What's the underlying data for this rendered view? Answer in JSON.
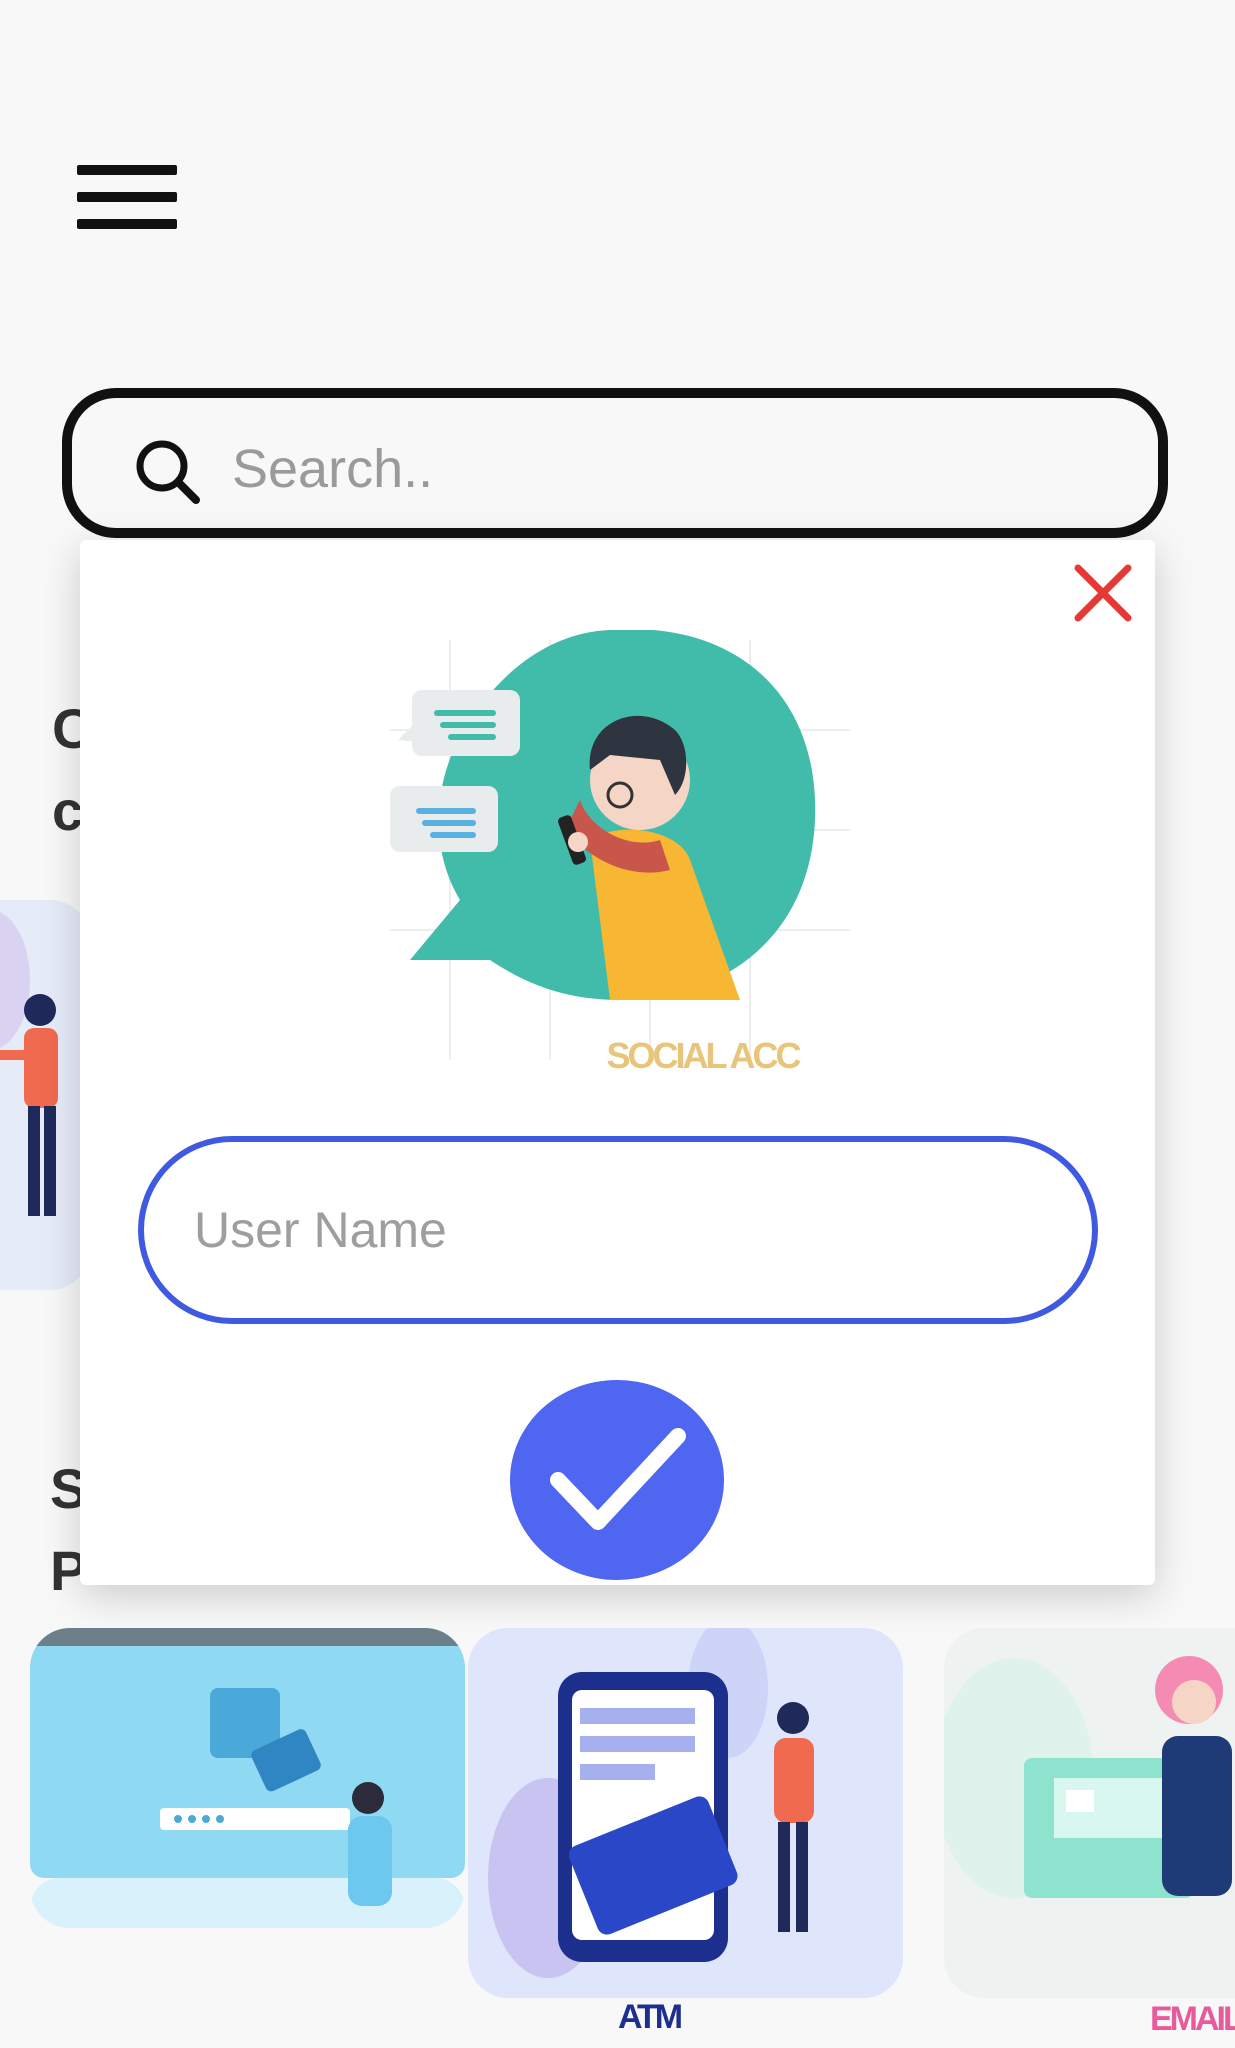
{
  "header": {
    "menu_icon": "hamburger-menu-icon"
  },
  "search": {
    "placeholder": "Search..",
    "icon": "search-icon"
  },
  "background": {
    "heading_partial_1": "C",
    "heading_partial_2": "c",
    "heading_partial_3": "S",
    "heading_partial_4": "P",
    "tiles": [
      {
        "label": ""
      },
      {
        "label": "ATM"
      },
      {
        "label": "EMAIL"
      }
    ]
  },
  "modal": {
    "illustration_label": "SOCIAL ACC",
    "username": {
      "placeholder": "User Name",
      "value": ""
    },
    "close_icon": "close-icon",
    "confirm_icon": "checkmark-icon"
  },
  "colors": {
    "accent": "#4f66f0",
    "input_border": "#3f5ae0",
    "close": "#e53935",
    "illustration_green": "#41bcaa"
  }
}
